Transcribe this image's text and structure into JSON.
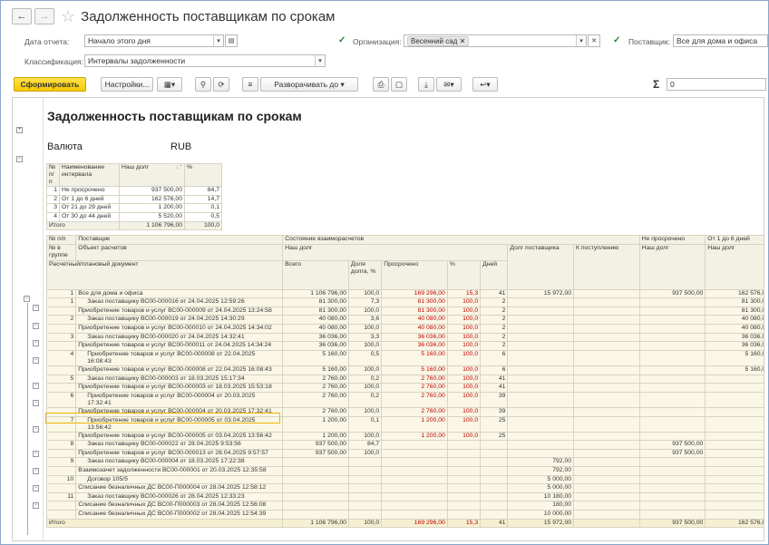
{
  "window": {
    "back_icon": "arrow-left-icon",
    "forward_icon": "arrow-right-icon",
    "title": "Задолженность поставщикам по срокам"
  },
  "filters": {
    "date_label": "Дата отчета:",
    "date_value": "Начало этого дня",
    "org_label": "Организация:",
    "org_value": "Весенний сад",
    "supplier_label": "Поставщик:",
    "supplier_value": "Все для дома и офиса",
    "class_label": "Классификация:",
    "class_value": "Интервалы задолженности"
  },
  "toolbar": {
    "generate": "Сформировать",
    "settings": "Настройки...",
    "expand": "Разворачивать до",
    "sigma": "Σ",
    "sum_value": "0"
  },
  "report": {
    "title": "Задолженность поставщикам по срокам",
    "currency_label": "Валюта",
    "currency_value": "RUB",
    "summary": {
      "h_num": "№ п/п",
      "h_name": "Наименование интервала",
      "h_debt": "Наш долг",
      "h_pct": "%",
      "rows": [
        {
          "n": "1",
          "name": "Не просрочено",
          "debt": "937 500,00",
          "pct": "84,7"
        },
        {
          "n": "2",
          "name": "От 1 до 6 дней",
          "debt": "162 576,00",
          "pct": "14,7"
        },
        {
          "n": "3",
          "name": "От 21 до 29 дней",
          "debt": "1 200,00",
          "pct": "0,1"
        },
        {
          "n": "4",
          "name": "От 30 до 44 дней",
          "debt": "5 520,00",
          "pct": "0,5"
        }
      ],
      "total_label": "Итого",
      "total_debt": "1 106 796,00",
      "total_pct": "100,0"
    },
    "main": {
      "h": {
        "num": "№ п/п",
        "supplier": "Поставщик",
        "state": "Состояние взаиморасчетов",
        "not_overdue": "Не просрочено",
        "d1_6": "От 1 до 6 дней",
        "num_in_group": "№ в группе",
        "object": "Объект расчетов",
        "our_debt": "Наш долг",
        "supplier_debt": "Долг поставщика",
        "incoming": "К поступлению",
        "our_debt2": "Наш долг",
        "our_debt3": "Наш долг",
        "doc": "Расчетный/плановый документ",
        "total": "Всего",
        "share": "Доля долга, %",
        "overdue": "Просрочено",
        "pct": "%",
        "days": "Дней"
      },
      "rows": [
        {
          "n": "1",
          "label": "Все для дома и офиса",
          "total": "1 106 796,00",
          "share": "100,0",
          "over": "169 296,00",
          "pct": "15,3",
          "days": "41",
          "sup": "15 972,00",
          "inc": "",
          "nd": "937 500,00",
          "d16": "162 576,00"
        },
        {
          "n": "1",
          "label": "Заказ поставщику ВС00-000016 от 24.04.2025 12:59:26",
          "total": "81 300,00",
          "share": "7,3",
          "over": "81 300,00",
          "pct": "100,0",
          "days": "2",
          "sup": "",
          "inc": "",
          "nd": "",
          "d16": "81 300,00"
        },
        {
          "n": "",
          "label": "Приобретение товаров и услуг ВС00-000009 от 24.04.2025 13:24:58",
          "total": "81 300,00",
          "share": "100,0",
          "over": "81 300,00",
          "pct": "100,0",
          "days": "2",
          "sup": "",
          "inc": "",
          "nd": "",
          "d16": "81 300,00"
        },
        {
          "n": "2",
          "label": "Заказ поставщику ВС00-000019 от 24.04.2025 14:30:29",
          "total": "40 080,00",
          "share": "3,6",
          "over": "40 080,00",
          "pct": "100,0",
          "days": "2",
          "sup": "",
          "inc": "",
          "nd": "",
          "d16": "40 080,00"
        },
        {
          "n": "",
          "label": "Приобретение товаров и услуг ВС00-000010 от 24.04.2025 14:34:02",
          "total": "40 080,00",
          "share": "100,0",
          "over": "40 080,00",
          "pct": "100,0",
          "days": "2",
          "sup": "",
          "inc": "",
          "nd": "",
          "d16": "40 080,00"
        },
        {
          "n": "3",
          "label": "Заказ поставщику ВС00-000020 от 24.04.2025 14:32:41",
          "total": "36 036,00",
          "share": "3,3",
          "over": "36 036,00",
          "pct": "100,0",
          "days": "2",
          "sup": "",
          "inc": "",
          "nd": "",
          "d16": "36 036,00"
        },
        {
          "n": "",
          "label": "Приобретение товаров и услуг ВС00-000011 от 24.04.2025 14:34:24",
          "total": "36 036,00",
          "share": "100,0",
          "over": "36 036,00",
          "pct": "100,0",
          "days": "2",
          "sup": "",
          "inc": "",
          "nd": "",
          "d16": "36 036,00"
        },
        {
          "n": "4",
          "label": "Приобретение товаров и услуг ВС00-000008 от 22.04.2025 16:08:43",
          "total": "5 160,00",
          "share": "0,5",
          "over": "5 160,00",
          "pct": "100,0",
          "days": "6",
          "sup": "",
          "inc": "",
          "nd": "",
          "d16": "5 160,00",
          "tall": true
        },
        {
          "n": "",
          "label": "Приобретение товаров и услуг ВС00-000008 от 22.04.2025 16:08:43",
          "total": "5 160,00",
          "share": "100,0",
          "over": "5 160,00",
          "pct": "100,0",
          "days": "6",
          "sup": "",
          "inc": "",
          "nd": "",
          "d16": "5 160,00"
        },
        {
          "n": "5",
          "label": "Заказ поставщику ВС00-000003 от 18.03.2025 15:17:34",
          "total": "2 760,00",
          "share": "0,2",
          "over": "2 760,00",
          "pct": "100,0",
          "days": "41",
          "sup": "",
          "inc": "",
          "nd": "",
          "d16": ""
        },
        {
          "n": "",
          "label": "Приобретение товаров и услуг ВС00-000003 от 18.03.2025 15:53:18",
          "total": "2 760,00",
          "share": "100,0",
          "over": "2 760,00",
          "pct": "100,0",
          "days": "41",
          "sup": "",
          "inc": "",
          "nd": "",
          "d16": ""
        },
        {
          "n": "6",
          "label": "Приобретение товаров и услуг ВС00-000004 от 20.03.2025 17:32:41",
          "total": "2 760,00",
          "share": "0,2",
          "over": "2 760,00",
          "pct": "100,0",
          "days": "39",
          "sup": "",
          "inc": "",
          "nd": "",
          "d16": "",
          "tall": true
        },
        {
          "n": "",
          "label": "Приобретение товаров и услуг ВС00-000004 от 20.03.2025 17:32:41",
          "total": "2 760,00",
          "share": "100,0",
          "over": "2 760,00",
          "pct": "100,0",
          "days": "39",
          "sup": "",
          "inc": "",
          "nd": "",
          "d16": ""
        },
        {
          "n": "7",
          "label": "Приобретение товаров и услуг ВС00-000005 от 03.04.2025 13:56:42",
          "total": "1 200,00",
          "share": "0,1",
          "over": "1 200,00",
          "pct": "100,0",
          "days": "25",
          "sup": "",
          "inc": "",
          "nd": "",
          "d16": "",
          "tall": true
        },
        {
          "n": "",
          "label": "Приобретение товаров и услуг ВС00-000005 от 03.04.2025 13:56:42",
          "total": "1 200,00",
          "share": "100,0",
          "over": "1 200,00",
          "pct": "100,0",
          "days": "25",
          "sup": "",
          "inc": "",
          "nd": "",
          "d16": ""
        },
        {
          "n": "8",
          "label": "Заказ поставщику ВС00-000022 от 28.04.2025 9:53:56",
          "total": "937 500,00",
          "share": "84,7",
          "over": "",
          "pct": "",
          "days": "",
          "sup": "",
          "inc": "",
          "nd": "937 500,00",
          "d16": ""
        },
        {
          "n": "",
          "label": "Приобретение товаров и услуг ВС00-000013 от 28.04.2025 9:57:57",
          "total": "937 500,00",
          "share": "100,0",
          "over": "",
          "pct": "",
          "days": "",
          "sup": "",
          "inc": "",
          "nd": "937 500,00",
          "d16": ""
        },
        {
          "n": "9",
          "label": "Заказ поставщику ВС00-000004 от 18.03.2025 17:22:38",
          "total": "",
          "share": "",
          "over": "",
          "pct": "",
          "days": "",
          "sup": "792,00",
          "inc": "",
          "nd": "",
          "d16": ""
        },
        {
          "n": "",
          "label": "Взаимозачет задолженности ВС00-000001 от 20.03.2025 12:35:58",
          "total": "",
          "share": "",
          "over": "",
          "pct": "",
          "days": "",
          "sup": "792,00",
          "inc": "",
          "nd": "",
          "d16": ""
        },
        {
          "n": "10",
          "label": "Договор 105/5",
          "total": "",
          "share": "",
          "over": "",
          "pct": "",
          "days": "",
          "sup": "5 000,00",
          "inc": "",
          "nd": "",
          "d16": ""
        },
        {
          "n": "",
          "label": "Списание безналичных ДС ВС00-П000004 от 28.04.2025 12:58:12",
          "total": "",
          "share": "",
          "over": "",
          "pct": "",
          "days": "",
          "sup": "5 000,00",
          "inc": "",
          "nd": "",
          "d16": ""
        },
        {
          "n": "11",
          "label": "Заказ поставщику ВС00-000026 от 28.04.2025 12:33:23",
          "total": "",
          "share": "",
          "over": "",
          "pct": "",
          "days": "",
          "sup": "10 180,00",
          "inc": "",
          "nd": "",
          "d16": ""
        },
        {
          "n": "",
          "label": "Списание безналичных ДС ВС00-П000003 от 28.04.2025 12:56:08",
          "total": "",
          "share": "",
          "over": "",
          "pct": "",
          "days": "",
          "sup": "180,00",
          "inc": "",
          "nd": "",
          "d16": ""
        },
        {
          "n": "",
          "label": "Списание безналичных ДС ВС00-П000002 от 28.04.2025 12:54:39",
          "total": "",
          "share": "",
          "over": "",
          "pct": "",
          "days": "",
          "sup": "10 000,00",
          "inc": "",
          "nd": "",
          "d16": ""
        }
      ],
      "total": {
        "label": "Итого",
        "total": "1 106 796,00",
        "share": "100,0",
        "over": "169 296,00",
        "pct": "15,3",
        "days": "41",
        "sup": "15 972,00",
        "inc": "",
        "nd": "937 500,00",
        "d16": "162 576,00"
      }
    }
  }
}
